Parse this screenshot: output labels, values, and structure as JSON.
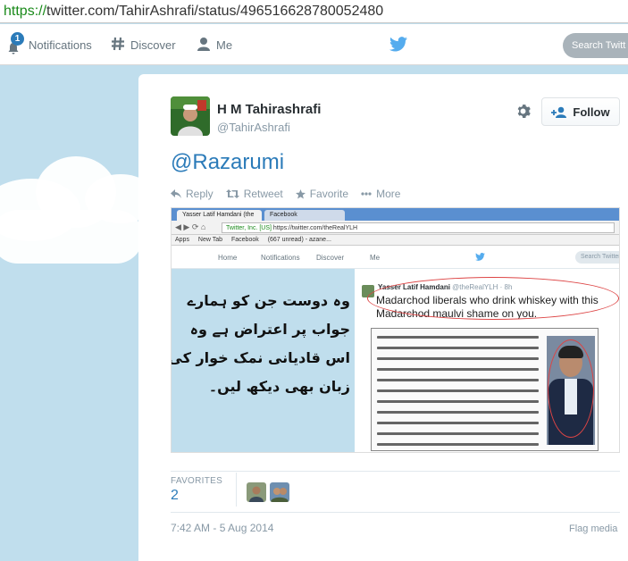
{
  "browser": {
    "url_protocol": "https://",
    "url_rest": "twitter.com/TahirAshrafi/status/496516628780052480"
  },
  "topnav": {
    "notifications_label": "Notifications",
    "notifications_badge": "1",
    "discover_label": "Discover",
    "me_label": "Me",
    "search_placeholder": "Search Twitt"
  },
  "tweet": {
    "fullname": "H M Tahirashrafi",
    "screen_name": "@TahirAshrafi",
    "follow_label": "Follow",
    "text": "@Razarumi",
    "actions": {
      "reply": "Reply",
      "retweet": "Retweet",
      "favorite": "Favorite",
      "more": "More"
    },
    "stats": {
      "favorites_label": "FAVORITES",
      "favorites_count": "2"
    },
    "timestamp": "7:42 AM - 5 Aug 2014",
    "flag_label": "Flag media"
  },
  "media": {
    "tab1": "Yasser Latif Hamdani (the",
    "tab2": "Facebook",
    "addr_secure": "Twitter, Inc. [US]",
    "addr_url": "https://twitter.com/theRealYLH",
    "bookmarks": [
      "Apps",
      "New Tab",
      "Facebook",
      "(667 unread) - azane..."
    ],
    "nav": {
      "home": "Home",
      "notifications": "Notifications",
      "discover": "Discover",
      "me": "Me",
      "search": "Search Twitter"
    },
    "urdu_lines": [
      "وہ دوست جن کو ہمارے",
      "جواب پر اعتراض ہے وہ",
      "اس قادیانی نمک خوار کی",
      "زبان بھی دیکھ لیں۔"
    ],
    "inner_name": "Yasser Latif Hamdani",
    "inner_handle": "@theRealYLH · 8h",
    "inner_text": "Madarchod liberals who drink whiskey with this Madarchod maulvi shame on you."
  },
  "colors": {
    "link": "#2b7bb9",
    "background": "#c0deed",
    "muted": "#8899a6"
  }
}
